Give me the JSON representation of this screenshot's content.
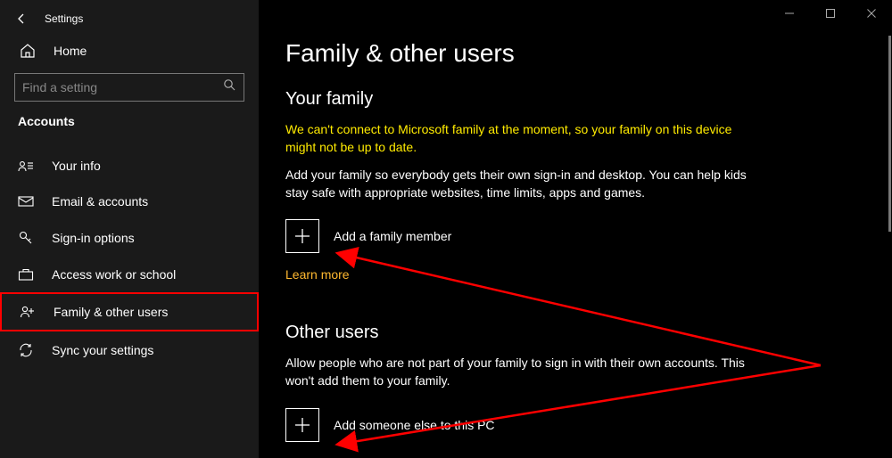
{
  "titlebar": {
    "app_title": "Settings"
  },
  "sidebar": {
    "home_label": "Home",
    "search_placeholder": "Find a setting",
    "section_header": "Accounts",
    "items": [
      {
        "label": "Your info"
      },
      {
        "label": "Email & accounts"
      },
      {
        "label": "Sign-in options"
      },
      {
        "label": "Access work or school"
      },
      {
        "label": "Family & other users"
      },
      {
        "label": "Sync your settings"
      }
    ]
  },
  "content": {
    "page_title": "Family & other users",
    "family": {
      "header": "Your family",
      "warning": "We can't connect to Microsoft family at the moment, so your family on this device might not be up to date.",
      "description": "Add your family so everybody gets their own sign-in and desktop. You can help kids stay safe with appropriate websites, time limits, apps and games.",
      "add_label": "Add a family member",
      "learn_more": "Learn more"
    },
    "other_users": {
      "header": "Other users",
      "description": "Allow people who are not part of your family to sign in with their own accounts. This won't add them to your family.",
      "add_label": "Add someone else to this PC"
    }
  },
  "annotation": {
    "highlight_item_index": 4,
    "arrow_color": "#ff0000"
  }
}
